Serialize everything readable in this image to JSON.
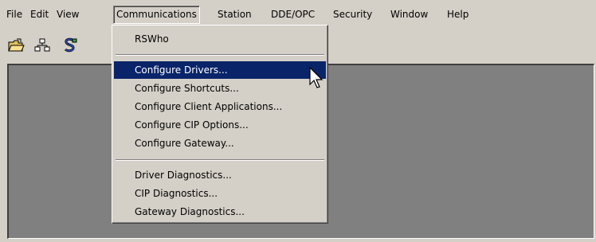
{
  "menubar": {
    "items": [
      "File",
      "Edit",
      "View",
      "Communications",
      "Station",
      "DDE/OPC",
      "Security",
      "Window",
      "Help"
    ]
  },
  "toolbar": {
    "icons": [
      "open-folder-icon",
      "network-icon",
      "rswho-icon"
    ]
  },
  "communications_menu": {
    "items": [
      "RSWho",
      "Configure Drivers...",
      "Configure Shortcuts...",
      "Configure Client Applications...",
      "Configure CIP Options...",
      "Configure Gateway...",
      "Driver Diagnostics...",
      "CIP Diagnostics...",
      "Gateway Diagnostics..."
    ],
    "highlighted": "Configure Drivers..."
  },
  "colors": {
    "face": "#d4d0c8",
    "client_area": "#808080",
    "highlight": "#0a246a"
  }
}
